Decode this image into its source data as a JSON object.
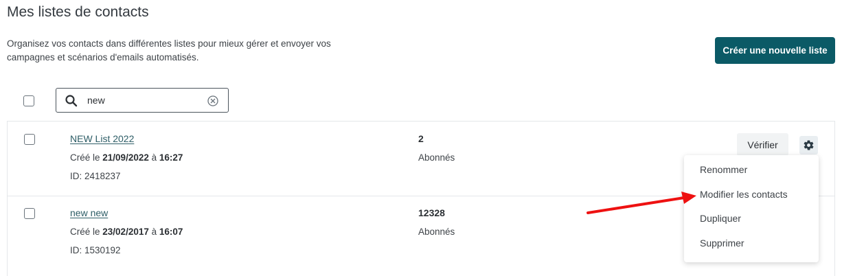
{
  "header": {
    "title": "Mes listes de contacts",
    "description_line1": "Organisez vos contacts dans différentes listes pour mieux gérer et envoyer vos",
    "description_line2": "campagnes et scénarios d'emails automatisés.",
    "create_button_label": "Créer une nouvelle liste"
  },
  "search": {
    "value": "new",
    "icon": "search-icon",
    "clear_icon": "clear-circle-icon"
  },
  "lists": [
    {
      "name": "NEW List 2022",
      "created_prefix": "Créé le ",
      "created_date": "21/09/2022",
      "created_sep": " à ",
      "created_time": "16:27",
      "id_label": "ID: 2418237",
      "count": "2",
      "count_label": "Abonnés"
    },
    {
      "name": "new new",
      "created_prefix": "Créé le ",
      "created_date": "23/02/2017",
      "created_sep": " à ",
      "created_time": "16:07",
      "id_label": "ID: 1530192",
      "count": "12328",
      "count_label": "Abonnés"
    }
  ],
  "row_actions": {
    "verify_label": "Vérifier",
    "settings_icon": "gear-icon"
  },
  "dropdown_menu": {
    "items": [
      "Renommer",
      "Modifier les contacts",
      "Dupliquer",
      "Supprimer"
    ]
  },
  "colors": {
    "primary": "#0b5a66",
    "link": "#2d5d66",
    "annotation_arrow": "#ee1111"
  }
}
